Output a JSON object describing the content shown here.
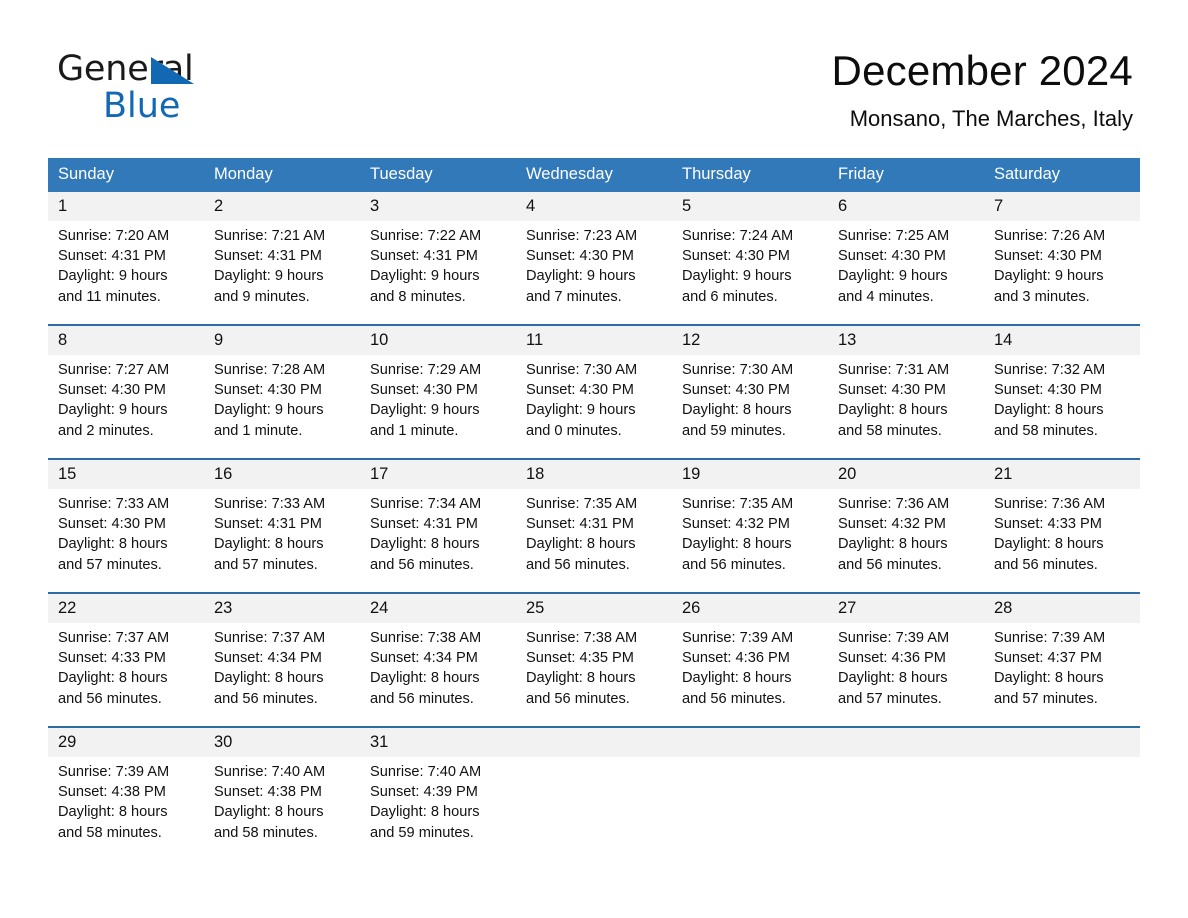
{
  "logo": {
    "word1": "General",
    "word2": "Blue",
    "triangle_color": "#1268b3"
  },
  "header": {
    "title": "December 2024",
    "subtitle": "Monsano, The Marches, Italy"
  },
  "theme": {
    "header_blue": "#3179b8",
    "row_rule_blue": "#2e6da4",
    "daynum_bg": "#f2f2f2"
  },
  "weekdays": [
    "Sunday",
    "Monday",
    "Tuesday",
    "Wednesday",
    "Thursday",
    "Friday",
    "Saturday"
  ],
  "weeks": [
    [
      {
        "day": "1",
        "sunrise": "Sunrise: 7:20 AM",
        "sunset": "Sunset: 4:31 PM",
        "daylight1": "Daylight: 9 hours",
        "daylight2": "and 11 minutes."
      },
      {
        "day": "2",
        "sunrise": "Sunrise: 7:21 AM",
        "sunset": "Sunset: 4:31 PM",
        "daylight1": "Daylight: 9 hours",
        "daylight2": "and 9 minutes."
      },
      {
        "day": "3",
        "sunrise": "Sunrise: 7:22 AM",
        "sunset": "Sunset: 4:31 PM",
        "daylight1": "Daylight: 9 hours",
        "daylight2": "and 8 minutes."
      },
      {
        "day": "4",
        "sunrise": "Sunrise: 7:23 AM",
        "sunset": "Sunset: 4:30 PM",
        "daylight1": "Daylight: 9 hours",
        "daylight2": "and 7 minutes."
      },
      {
        "day": "5",
        "sunrise": "Sunrise: 7:24 AM",
        "sunset": "Sunset: 4:30 PM",
        "daylight1": "Daylight: 9 hours",
        "daylight2": "and 6 minutes."
      },
      {
        "day": "6",
        "sunrise": "Sunrise: 7:25 AM",
        "sunset": "Sunset: 4:30 PM",
        "daylight1": "Daylight: 9 hours",
        "daylight2": "and 4 minutes."
      },
      {
        "day": "7",
        "sunrise": "Sunrise: 7:26 AM",
        "sunset": "Sunset: 4:30 PM",
        "daylight1": "Daylight: 9 hours",
        "daylight2": "and 3 minutes."
      }
    ],
    [
      {
        "day": "8",
        "sunrise": "Sunrise: 7:27 AM",
        "sunset": "Sunset: 4:30 PM",
        "daylight1": "Daylight: 9 hours",
        "daylight2": "and 2 minutes."
      },
      {
        "day": "9",
        "sunrise": "Sunrise: 7:28 AM",
        "sunset": "Sunset: 4:30 PM",
        "daylight1": "Daylight: 9 hours",
        "daylight2": "and 1 minute."
      },
      {
        "day": "10",
        "sunrise": "Sunrise: 7:29 AM",
        "sunset": "Sunset: 4:30 PM",
        "daylight1": "Daylight: 9 hours",
        "daylight2": "and 1 minute."
      },
      {
        "day": "11",
        "sunrise": "Sunrise: 7:30 AM",
        "sunset": "Sunset: 4:30 PM",
        "daylight1": "Daylight: 9 hours",
        "daylight2": "and 0 minutes."
      },
      {
        "day": "12",
        "sunrise": "Sunrise: 7:30 AM",
        "sunset": "Sunset: 4:30 PM",
        "daylight1": "Daylight: 8 hours",
        "daylight2": "and 59 minutes."
      },
      {
        "day": "13",
        "sunrise": "Sunrise: 7:31 AM",
        "sunset": "Sunset: 4:30 PM",
        "daylight1": "Daylight: 8 hours",
        "daylight2": "and 58 minutes."
      },
      {
        "day": "14",
        "sunrise": "Sunrise: 7:32 AM",
        "sunset": "Sunset: 4:30 PM",
        "daylight1": "Daylight: 8 hours",
        "daylight2": "and 58 minutes."
      }
    ],
    [
      {
        "day": "15",
        "sunrise": "Sunrise: 7:33 AM",
        "sunset": "Sunset: 4:30 PM",
        "daylight1": "Daylight: 8 hours",
        "daylight2": "and 57 minutes."
      },
      {
        "day": "16",
        "sunrise": "Sunrise: 7:33 AM",
        "sunset": "Sunset: 4:31 PM",
        "daylight1": "Daylight: 8 hours",
        "daylight2": "and 57 minutes."
      },
      {
        "day": "17",
        "sunrise": "Sunrise: 7:34 AM",
        "sunset": "Sunset: 4:31 PM",
        "daylight1": "Daylight: 8 hours",
        "daylight2": "and 56 minutes."
      },
      {
        "day": "18",
        "sunrise": "Sunrise: 7:35 AM",
        "sunset": "Sunset: 4:31 PM",
        "daylight1": "Daylight: 8 hours",
        "daylight2": "and 56 minutes."
      },
      {
        "day": "19",
        "sunrise": "Sunrise: 7:35 AM",
        "sunset": "Sunset: 4:32 PM",
        "daylight1": "Daylight: 8 hours",
        "daylight2": "and 56 minutes."
      },
      {
        "day": "20",
        "sunrise": "Sunrise: 7:36 AM",
        "sunset": "Sunset: 4:32 PM",
        "daylight1": "Daylight: 8 hours",
        "daylight2": "and 56 minutes."
      },
      {
        "day": "21",
        "sunrise": "Sunrise: 7:36 AM",
        "sunset": "Sunset: 4:33 PM",
        "daylight1": "Daylight: 8 hours",
        "daylight2": "and 56 minutes."
      }
    ],
    [
      {
        "day": "22",
        "sunrise": "Sunrise: 7:37 AM",
        "sunset": "Sunset: 4:33 PM",
        "daylight1": "Daylight: 8 hours",
        "daylight2": "and 56 minutes."
      },
      {
        "day": "23",
        "sunrise": "Sunrise: 7:37 AM",
        "sunset": "Sunset: 4:34 PM",
        "daylight1": "Daylight: 8 hours",
        "daylight2": "and 56 minutes."
      },
      {
        "day": "24",
        "sunrise": "Sunrise: 7:38 AM",
        "sunset": "Sunset: 4:34 PM",
        "daylight1": "Daylight: 8 hours",
        "daylight2": "and 56 minutes."
      },
      {
        "day": "25",
        "sunrise": "Sunrise: 7:38 AM",
        "sunset": "Sunset: 4:35 PM",
        "daylight1": "Daylight: 8 hours",
        "daylight2": "and 56 minutes."
      },
      {
        "day": "26",
        "sunrise": "Sunrise: 7:39 AM",
        "sunset": "Sunset: 4:36 PM",
        "daylight1": "Daylight: 8 hours",
        "daylight2": "and 56 minutes."
      },
      {
        "day": "27",
        "sunrise": "Sunrise: 7:39 AM",
        "sunset": "Sunset: 4:36 PM",
        "daylight1": "Daylight: 8 hours",
        "daylight2": "and 57 minutes."
      },
      {
        "day": "28",
        "sunrise": "Sunrise: 7:39 AM",
        "sunset": "Sunset: 4:37 PM",
        "daylight1": "Daylight: 8 hours",
        "daylight2": "and 57 minutes."
      }
    ],
    [
      {
        "day": "29",
        "sunrise": "Sunrise: 7:39 AM",
        "sunset": "Sunset: 4:38 PM",
        "daylight1": "Daylight: 8 hours",
        "daylight2": "and 58 minutes."
      },
      {
        "day": "30",
        "sunrise": "Sunrise: 7:40 AM",
        "sunset": "Sunset: 4:38 PM",
        "daylight1": "Daylight: 8 hours",
        "daylight2": "and 58 minutes."
      },
      {
        "day": "31",
        "sunrise": "Sunrise: 7:40 AM",
        "sunset": "Sunset: 4:39 PM",
        "daylight1": "Daylight: 8 hours",
        "daylight2": "and 59 minutes."
      },
      {
        "day": "",
        "sunrise": "",
        "sunset": "",
        "daylight1": "",
        "daylight2": ""
      },
      {
        "day": "",
        "sunrise": "",
        "sunset": "",
        "daylight1": "",
        "daylight2": ""
      },
      {
        "day": "",
        "sunrise": "",
        "sunset": "",
        "daylight1": "",
        "daylight2": ""
      },
      {
        "day": "",
        "sunrise": "",
        "sunset": "",
        "daylight1": "",
        "daylight2": ""
      }
    ]
  ]
}
